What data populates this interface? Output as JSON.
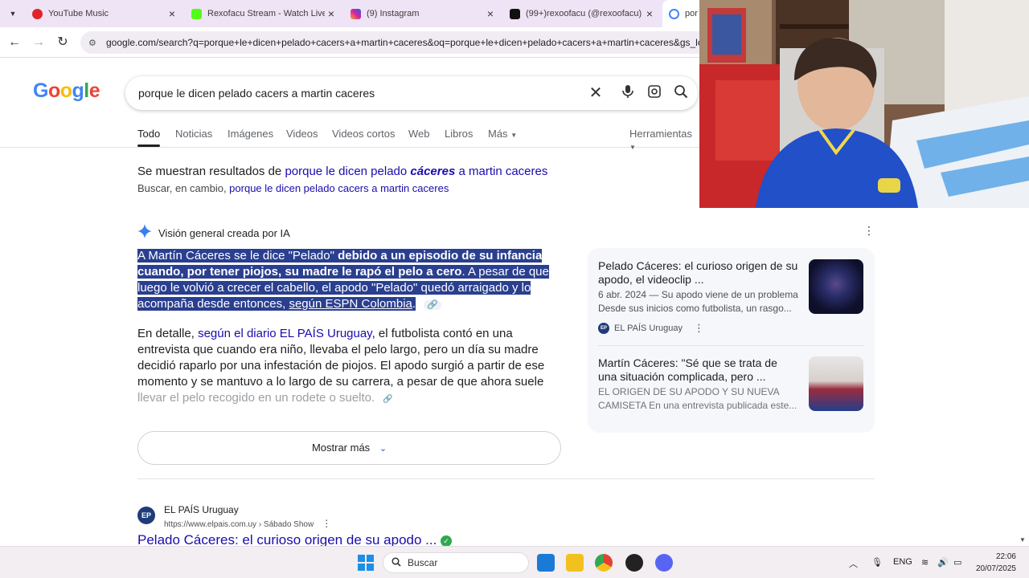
{
  "tabs": [
    {
      "title": "YouTube Music",
      "color": "#e0242a"
    },
    {
      "title": "Rexofacu Stream - Watch Live o",
      "color": "#53fc18"
    },
    {
      "title": "(9) Instagram",
      "color": "#d6249f"
    },
    {
      "title": "(99+)rexoofacu (@rexoofacu) |",
      "color": "#111111"
    },
    {
      "title": "por",
      "color": "#4285f4"
    }
  ],
  "address_bar": {
    "url": "google.com/search?q=porque+le+dicen+pelado+cacers+a+martin+caceres&oq=porque+le+dicen+pelado+cacers+a+martin+caceres&gs_lcrp"
  },
  "google": {
    "logo": [
      "G",
      "o",
      "o",
      "g",
      "l",
      "e"
    ],
    "logo_colors": [
      "#4285f4",
      "#ea4335",
      "#fbbc05",
      "#4285f4",
      "#34a853",
      "#ea4335"
    ],
    "query": "porque le dicen pelado cacers a martin caceres"
  },
  "filters": [
    "Todo",
    "Noticias",
    "Imágenes",
    "Videos",
    "Videos cortos",
    "Web",
    "Libros",
    "Más",
    "Herramientas"
  ],
  "spelling": {
    "showing_prefix": "Se muestran resultados de ",
    "corrected_a": "porque le dicen pelado ",
    "corrected_b": "cáceres",
    "corrected_c": " a martin caceres",
    "instead_prefix": "Buscar, en cambio, ",
    "instead_link": "porque le dicen pelado cacers a martin caceres"
  },
  "ai_overview": {
    "header": "Visión general creada por IA",
    "p1_a": "A Martín Cáceres se le dice \"Pelado\" ",
    "p1_b": "debido a un episodio de su infancia cuando, por tener piojos, su madre le rapó el pelo a cero",
    "p1_c": ". A pesar de que luego le volvió a crecer el cabello, el apodo \"Pelado\" quedó arraigado y lo acompaña desde entonces, ",
    "p1_link": "según ESPN Colombia",
    "p1_end": ".",
    "p2_a": "En detalle, ",
    "p2_link": "según el diario EL PAÍS Uruguay",
    "p2_b": ", el futbolista contó en una entrevista que cuando era niño, llevaba el pelo largo, pero un día su madre decidió raparlo por una infestación de piojos. El apodo surgió a partir de ese momento y se mantuvo a lo largo de su carrera, a pesar de que ahora suele ",
    "p2_fade": "llevar el pelo recogido en un rodete o suelto.",
    "show_more": "Mostrar más"
  },
  "side_cards": [
    {
      "title": "Pelado Cáceres: el curioso origen de su apodo, el videoclip ...",
      "date": "6 abr. 2024",
      "snippet": " — Su apodo viene de un problema Desde sus inicios como futbolista, un rasgo...",
      "source": "EL PAÍS Uruguay"
    },
    {
      "title": "Martín Cáceres: \"Sé que se trata de una situación complicada, pero ...",
      "snippet": "EL ORIGEN DE SU APODO Y SU NUEVA CAMISETA En una entrevista publicada este..."
    }
  ],
  "result": {
    "site": "EL PAÍS Uruguay",
    "url": "https://www.elpais.com.uy › Sábado Show",
    "title": "Pelado Cáceres: el curioso origen de su apodo ..."
  },
  "taskbar": {
    "search": "Buscar",
    "lang": "ENG",
    "time": "22:06",
    "date": "20/07/2025"
  }
}
